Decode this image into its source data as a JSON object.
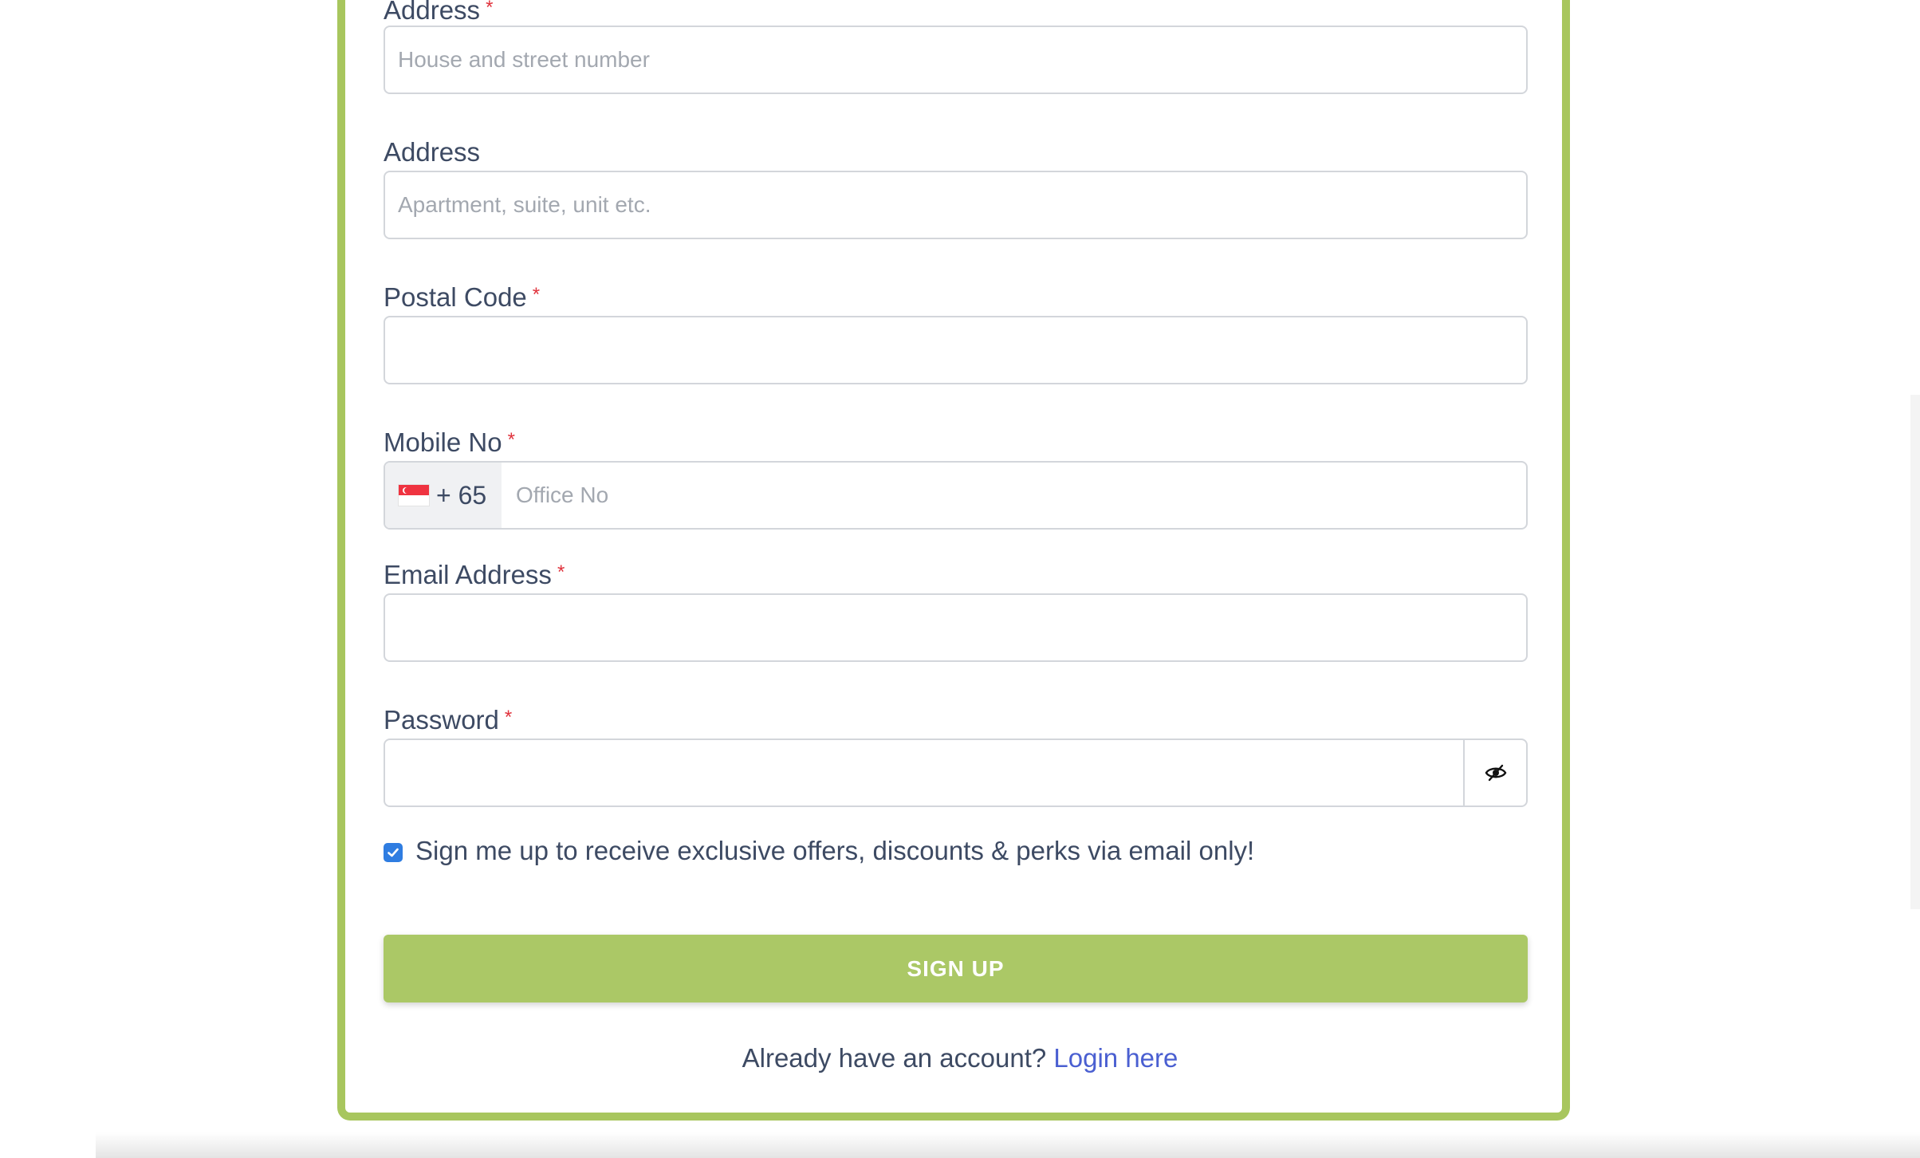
{
  "form": {
    "address1": {
      "label": "Address",
      "required_mark": "*",
      "placeholder": "House and street number",
      "value": ""
    },
    "address2": {
      "label": "Address",
      "placeholder": "Apartment, suite, unit etc.",
      "value": ""
    },
    "postal_code": {
      "label": "Postal Code",
      "required_mark": "*",
      "value": ""
    },
    "mobile": {
      "label": "Mobile No",
      "required_mark": "*",
      "country_flag_icon": "singapore-flag-icon",
      "dial_code": "+ 65",
      "placeholder": "Office No",
      "value": ""
    },
    "email": {
      "label": "Email Address",
      "required_mark": "*",
      "value": ""
    },
    "password": {
      "label": "Password",
      "required_mark": "*",
      "value": "",
      "toggle_icon": "eye-slash-icon"
    },
    "newsletter": {
      "checked": true,
      "label": "Sign me up to receive exclusive offers, discounts & perks via email only!"
    },
    "submit_label": "SIGN UP",
    "login_prompt": "Already have an account?",
    "login_link": "Login here"
  },
  "colors": {
    "accent_green": "#abc866",
    "card_border": "#a8c65e",
    "required_red": "#e0323c",
    "link_blue": "#4a5fd1",
    "checkbox_blue": "#2f7de1",
    "label_text": "#3d4a63"
  }
}
